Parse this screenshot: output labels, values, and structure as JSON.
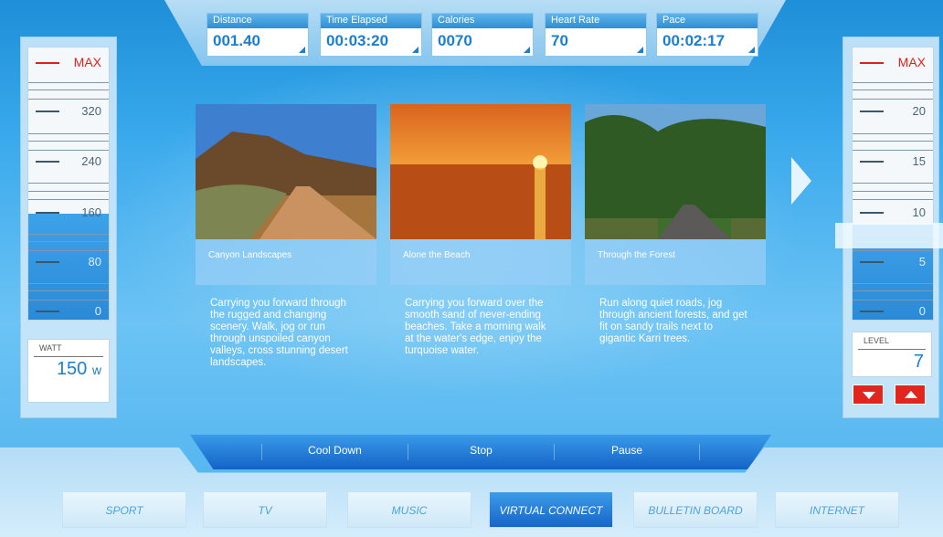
{
  "metrics": [
    {
      "label": "Distance",
      "value": "001.40"
    },
    {
      "label": "Time Elapsed",
      "value": "00:03:20"
    },
    {
      "label": "Calories",
      "value": "0070"
    },
    {
      "label": "Heart Rate",
      "value": "70"
    },
    {
      "label": "Pace",
      "value": "00:02:17"
    }
  ],
  "watt_gauge": {
    "max_label": "MAX",
    "ticks": [
      "320",
      "240",
      "160",
      "80",
      "0"
    ],
    "fill_fraction": 0.39,
    "box_label": "WATT",
    "value": "150",
    "unit": "w"
  },
  "level_gauge": {
    "max_label": "MAX",
    "ticks": [
      "20",
      "15",
      "10",
      "5",
      "0"
    ],
    "box_label": "LEVEL",
    "value": "7",
    "level_fraction": 0.35
  },
  "cards": [
    {
      "title": "Canyon Landscapes",
      "description": "Carrying you forward through the rugged and changing scenery. Walk, jog or run through unspoiled canyon valleys, cross stunning desert landscapes."
    },
    {
      "title": "Alone the Beach",
      "description": "Carrying you forward over the smooth sand of never-ending beaches. Take a morning walk at the water's edge, enjoy the turquoise water."
    },
    {
      "title": "Through the Forest",
      "description": "Run along quiet roads, jog through ancient forests, and get fit on sandy trails next to gigantic Karri trees."
    }
  ],
  "controls": [
    "Cool Down",
    "Stop",
    "Pause"
  ],
  "nav": [
    {
      "label": "SPORT",
      "active": false
    },
    {
      "label": "TV",
      "active": false
    },
    {
      "label": "MUSIC",
      "active": false
    },
    {
      "label": "VIRTUAL CONNECT",
      "active": true
    },
    {
      "label": "BULLETIN BOARD",
      "active": false
    },
    {
      "label": "INTERNET",
      "active": false
    }
  ],
  "colors": {
    "accent": "#1a7fd0",
    "alert": "#e0261e",
    "active_nav": "#1766c8"
  }
}
